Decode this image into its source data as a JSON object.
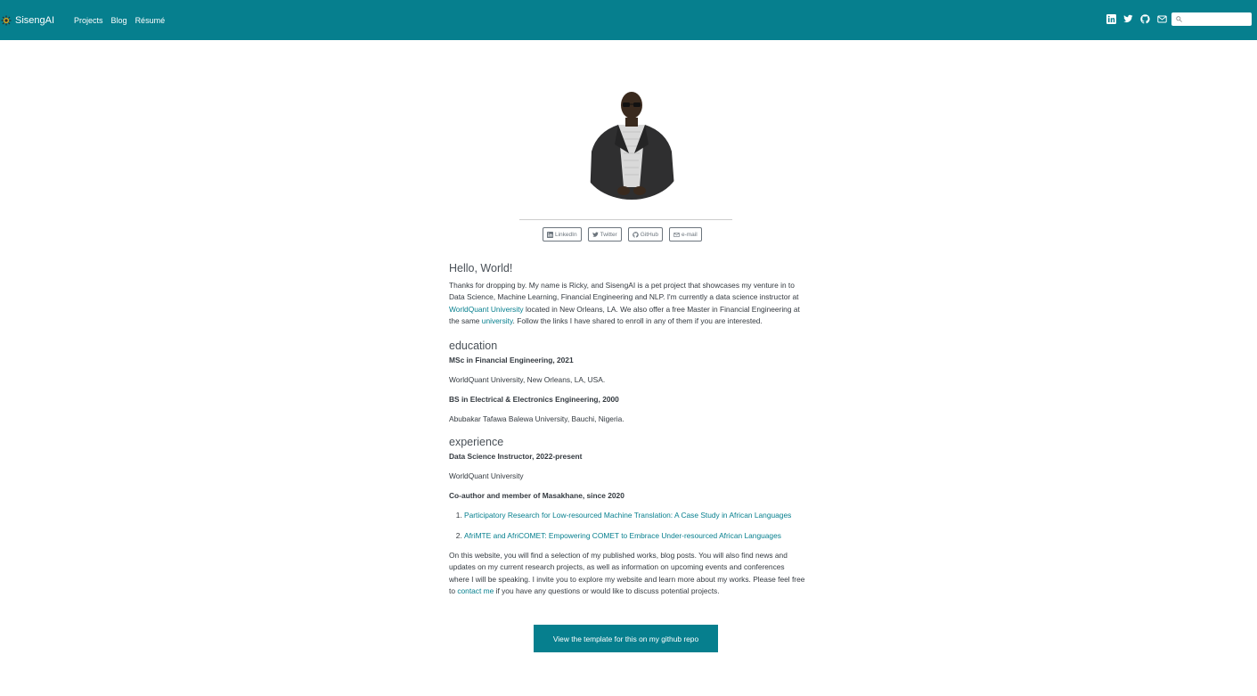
{
  "nav": {
    "brand": "SisengAI",
    "links": [
      "Projects",
      "Blog",
      "Résumé"
    ],
    "search_placeholder": ""
  },
  "social": {
    "linkedin": "LinkedIn",
    "twitter": "Twitter",
    "github": "GitHub",
    "email": "e-mail"
  },
  "intro": {
    "heading": "Hello, World!",
    "p1": "Thanks for dropping by. My name is Ricky, and SisengAI is a pet project that showcases my venture in to Data Science, Machine Learning, Financial Engineering and NLP. I'm currently a data science instructor at ",
    "link1": "WorldQuant University",
    "p2": " located in New Orleans, LA. We also offer a free Master in Financial Engineering at the same ",
    "link2": "university",
    "p3": ". Follow the links I have shared to enroll in any of them if you are interested."
  },
  "education": {
    "heading": "education",
    "items": [
      {
        "degree": "MSc in Financial Engineering, 2021",
        "institution": "WorldQuant University, New Orleans, LA, USA."
      },
      {
        "degree": "BS in Electrical & Electronics Engineering, 2000",
        "institution": "Abubakar Tafawa Balewa University, Bauchi, Nigeria."
      }
    ]
  },
  "experience": {
    "heading": "experience",
    "role1": "Data Science Instructor, 2022-present",
    "org1": "WorldQuant University",
    "role2": "Co-author and member of Masakhane, since 2020",
    "pubs": [
      "Participatory Research for Low-resourced Machine Translation: A Case Study in African Languages",
      "AfriMTE and AfriCOMET: Empowering COMET to Embrace Under-resourced African Languages"
    ]
  },
  "outro": {
    "p1": "On this website, you will find a selection of my published works, blog posts. You will also find news and updates on my current research projects, as well as information on upcoming events and conferences where I will be speaking. I invite you to explore my website and learn more about my works. Please feel free to ",
    "link": "contact me",
    "p2": " if you have any questions or would like to discuss potential projects."
  },
  "cta": "View the template for this on my github repo"
}
